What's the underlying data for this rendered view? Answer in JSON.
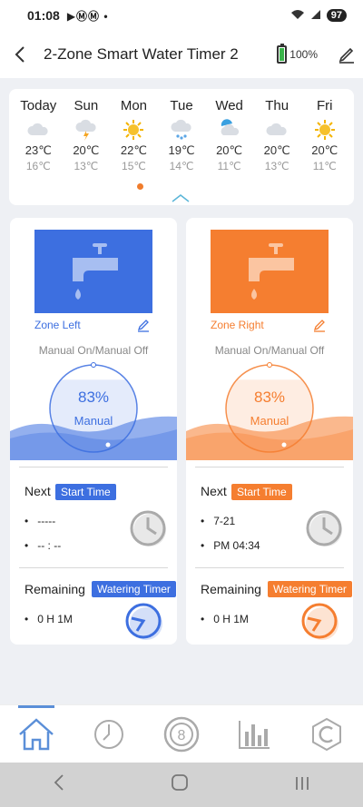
{
  "status_bar": {
    "time": "01:08",
    "notif_icons": "▶ⓂⓂ •",
    "battery": "97"
  },
  "header": {
    "title": "2-Zone Smart Water Timer 2",
    "battery_pct": "100%",
    "battery_level": 1.0
  },
  "weather": [
    {
      "day": "Today",
      "icon": "cloud-icon",
      "high": "23℃",
      "low": "16℃"
    },
    {
      "day": "Sun",
      "icon": "thunder-cloud-icon",
      "high": "20℃",
      "low": "13℃"
    },
    {
      "day": "Mon",
      "icon": "sun-icon",
      "high": "22℃",
      "low": "15℃"
    },
    {
      "day": "Tue",
      "icon": "rain-cloud-icon",
      "high": "19℃",
      "low": "14℃"
    },
    {
      "day": "Wed",
      "icon": "partly-cloudy-icon",
      "high": "20℃",
      "low": "11℃"
    },
    {
      "day": "Thu",
      "icon": "cloud-icon",
      "high": "20℃",
      "low": "13℃"
    },
    {
      "day": "Fri",
      "icon": "sun-icon",
      "high": "20℃",
      "low": "11℃"
    }
  ],
  "zones": {
    "left": {
      "name": "Zone Left",
      "mode": "Manual On/Manual Off",
      "percent": "83%",
      "percent_value": 0.83,
      "state": "Manual",
      "next_label": "Next",
      "start_time_label": "Start Time",
      "next_date": "-----",
      "next_time": "-- : --",
      "remaining_label": "Remaining",
      "watering_timer_label": "Watering Timer",
      "remaining_value": "0 H 1M",
      "color": "#3d6fe0"
    },
    "right": {
      "name": "Zone Right",
      "mode": "Manual On/Manual Off",
      "percent": "83%",
      "percent_value": 0.83,
      "state": "Manual",
      "next_label": "Next",
      "start_time_label": "Start Time",
      "next_date": "7-21",
      "next_time": "PM 04:34",
      "remaining_label": "Remaining",
      "watering_timer_label": "Watering Timer",
      "remaining_value": "0 H 1M",
      "color": "#f57e30"
    }
  },
  "tabs": [
    {
      "name": "home-icon",
      "active": true
    },
    {
      "name": "timer-icon",
      "active": false
    },
    {
      "name": "cycle-icon",
      "active": false
    },
    {
      "name": "statistics-icon",
      "active": false
    },
    {
      "name": "settings-icon",
      "active": false
    }
  ],
  "colors": {
    "blue": "#3d6fe0",
    "orange": "#f57e30",
    "tab_active": "#5b8fd8"
  }
}
